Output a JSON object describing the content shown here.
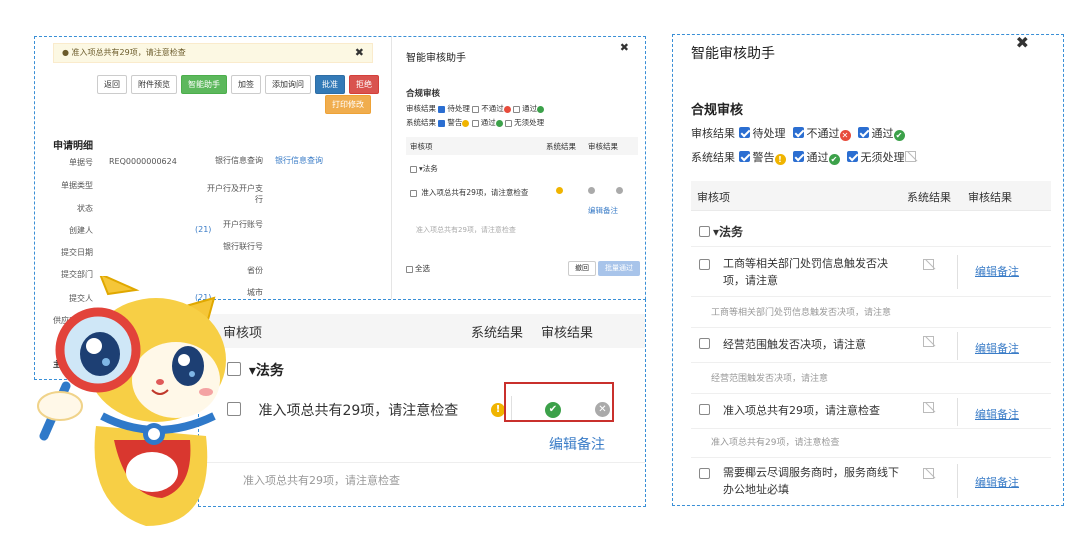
{
  "left_form": {
    "alert_text": "准入项总共有29项，请注意检查",
    "buttons": [
      "返回",
      "附件预览",
      "智能助手",
      "加签",
      "添加询问",
      "批准",
      "拒绝"
    ],
    "print_button": "打印修改",
    "section_title": "申请明细",
    "fields_left": [
      {
        "label": "单据号",
        "value": "REQ0000000624"
      },
      {
        "label": "单据类型",
        "value": ""
      },
      {
        "label": "状态",
        "value": ""
      },
      {
        "label": "创建人",
        "value": "(21)"
      },
      {
        "label": "提交日期",
        "value": ""
      },
      {
        "label": "提交部门",
        "value": ""
      },
      {
        "label": "提交人",
        "value": "(21)"
      },
      {
        "label": "供应商查询",
        "value": ""
      }
    ],
    "fields_right": [
      {
        "label": "银行信息查询",
        "value": "银行信息查询"
      },
      {
        "label": "开户行及开户支行",
        "value": ""
      },
      {
        "label": "开户行账号",
        "value": ""
      },
      {
        "label": "银行联行号",
        "value": ""
      },
      {
        "label": "省份",
        "value": ""
      },
      {
        "label": "城市",
        "value": ""
      }
    ],
    "side_label": "主"
  },
  "small_panel": {
    "title": "智能审核助手",
    "compliance": "合规审核",
    "review_result_label": "审核结果",
    "review_opts": [
      "待处理",
      "不通过",
      "通过"
    ],
    "system_result_label": "系统结果",
    "system_opts": [
      "警告",
      "通过",
      "无须处理"
    ],
    "col_item": "审核项",
    "col_system": "系统结果",
    "col_review": "审核结果",
    "group": "法务",
    "item": "准入项总共有29项，请注意检查",
    "edit_note": "编辑备注",
    "note": "准入项总共有29项，请注意检查",
    "select_all": "全选",
    "undo": "撤回",
    "batch_pass": "批量通过"
  },
  "zoom_panel": {
    "col_item": "审核项",
    "col_system": "系统结果",
    "col_review": "审核结果",
    "group": "法务",
    "item": "准入项总共有29项，请注意检查",
    "edit_note": "编辑备注",
    "note": "准入项总共有29项，请注意检查",
    "highlight_color": "#c9302c"
  },
  "right_panel": {
    "title": "智能审核助手",
    "compliance": "合规审核",
    "review_result_label": "审核结果",
    "review_opts": [
      "待处理",
      "不通过",
      "通过"
    ],
    "system_result_label": "系统结果",
    "system_opts": [
      "警告",
      "通过",
      "无须处理"
    ],
    "col_item": "审核项",
    "col_system": "系统结果",
    "col_review": "审核结果",
    "group": "法务",
    "items": [
      {
        "text": "工商等相关部门处罚信息触发否决项，请注意",
        "note": "工商等相关部门处罚信息触发否决项，请注意",
        "action": "编辑备注"
      },
      {
        "text": "经营范围触发否决项，请注意",
        "note": "经营范围触发否决项，请注意",
        "action": "编辑备注"
      },
      {
        "text": "准入项总共有29项，请注意检查",
        "note": "准入项总共有29项，请注意检查",
        "action": "编辑备注"
      },
      {
        "text": "需要椰云尽调服务商时，服务商线下办公地址必填",
        "note": "",
        "action": "编辑备注"
      }
    ]
  },
  "colors": {
    "accent": "#2b6ed1",
    "link": "#3a7cc7",
    "dash": "#3a8fd6",
    "pass": "#3ca14a",
    "fail": "#e74c3c",
    "warn": "#f0b400"
  }
}
